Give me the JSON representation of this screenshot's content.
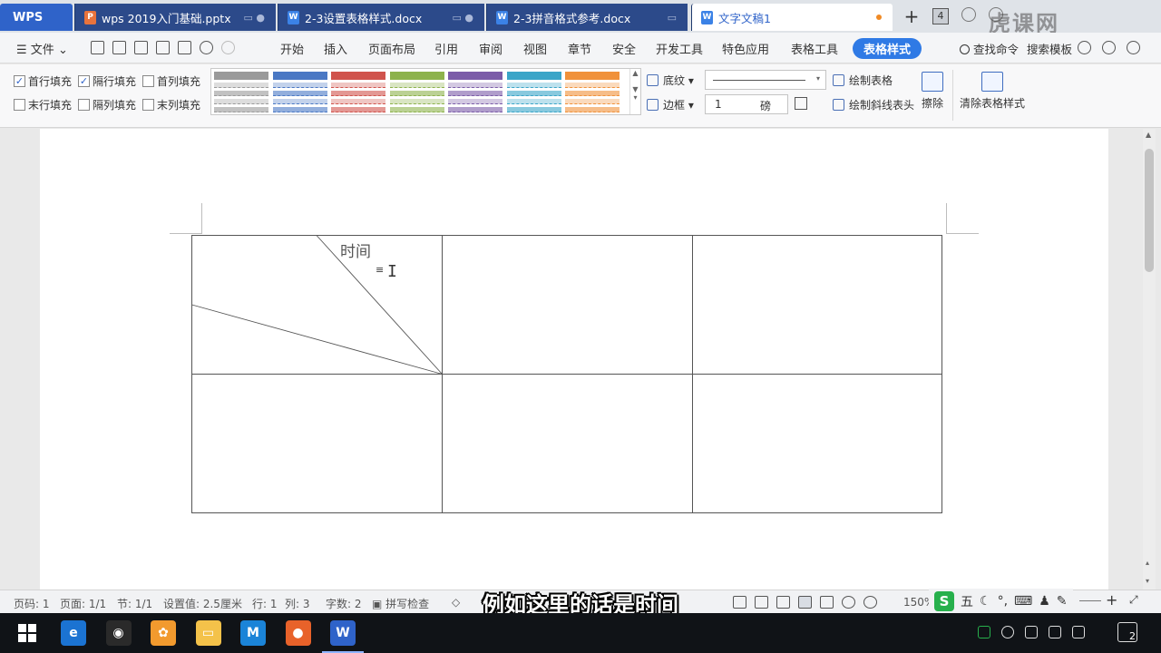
{
  "app": {
    "logo": "WPS"
  },
  "tabs": [
    {
      "label": "wps 2019入门基础.pptx",
      "type": "P",
      "color": "#e8733c"
    },
    {
      "label": "2-3设置表格样式.docx",
      "type": "W",
      "color": "#3b82e6"
    },
    {
      "label": "2-3拼音格式参考.docx",
      "type": "W",
      "color": "#3b82e6"
    },
    {
      "label": "文字文稿1",
      "type": "W",
      "color": "#3b82e6",
      "active": true
    }
  ],
  "tab_count": "4",
  "watermark": "虎课网",
  "menu": {
    "file": "文件",
    "items": [
      "开始",
      "插入",
      "页面布局",
      "引用",
      "审阅",
      "视图",
      "章节",
      "安全",
      "开发工具",
      "特色应用",
      "表格工具",
      "表格样式"
    ],
    "active": "表格样式",
    "search": "查找命令",
    "template": "搜索模板"
  },
  "ribbon": {
    "checkboxes": [
      {
        "label": "首行填充",
        "checked": true
      },
      {
        "label": "隔行填充",
        "checked": true
      },
      {
        "label": "首列填充",
        "checked": false
      },
      {
        "label": "末行填充",
        "checked": false
      },
      {
        "label": "隔列填充",
        "checked": false
      },
      {
        "label": "末列填充",
        "checked": false
      }
    ],
    "gallery_colors": [
      "#9a9a9a",
      "#4a78c4",
      "#d0534c",
      "#8db24c",
      "#7b5ca8",
      "#3aa5c8",
      "#f0913a"
    ],
    "shading": "底纹",
    "border": "边框",
    "line_weight": "1",
    "line_weight_unit": "磅",
    "draw_table": "绘制表格",
    "draw_diagonal": "绘制斜线表头",
    "erase": "擦除",
    "clear_style": "清除表格样式"
  },
  "document": {
    "cell_text": "时间"
  },
  "status": {
    "page_code": "页码: 1",
    "pages": "页面: 1/1",
    "section": "节: 1/1",
    "setting": "设置值: 2.5厘米",
    "row": "行: 1",
    "col": "列: 3",
    "wordcount": "字数: 2",
    "spellcheck": "拼写检查",
    "zoom": "150%"
  },
  "ime": {
    "logo": "S",
    "mode": "五"
  },
  "subtitle": "例如这里的话是时间",
  "taskbar": {
    "apps": [
      {
        "name": "edge",
        "glyph": "e",
        "color": "#1b73d2"
      },
      {
        "name": "obs",
        "glyph": "◉",
        "color": "#2a2a2a"
      },
      {
        "name": "photo",
        "glyph": "✿",
        "color": "#f29a2e"
      },
      {
        "name": "explorer",
        "glyph": "▭",
        "color": "#f4c24a"
      },
      {
        "name": "maxthon",
        "glyph": "M",
        "color": "#1b84d8"
      },
      {
        "name": "firefox",
        "glyph": "●",
        "color": "#e8622a"
      },
      {
        "name": "wps",
        "glyph": "W",
        "color": "#2f63c9"
      }
    ],
    "badge": "2"
  }
}
